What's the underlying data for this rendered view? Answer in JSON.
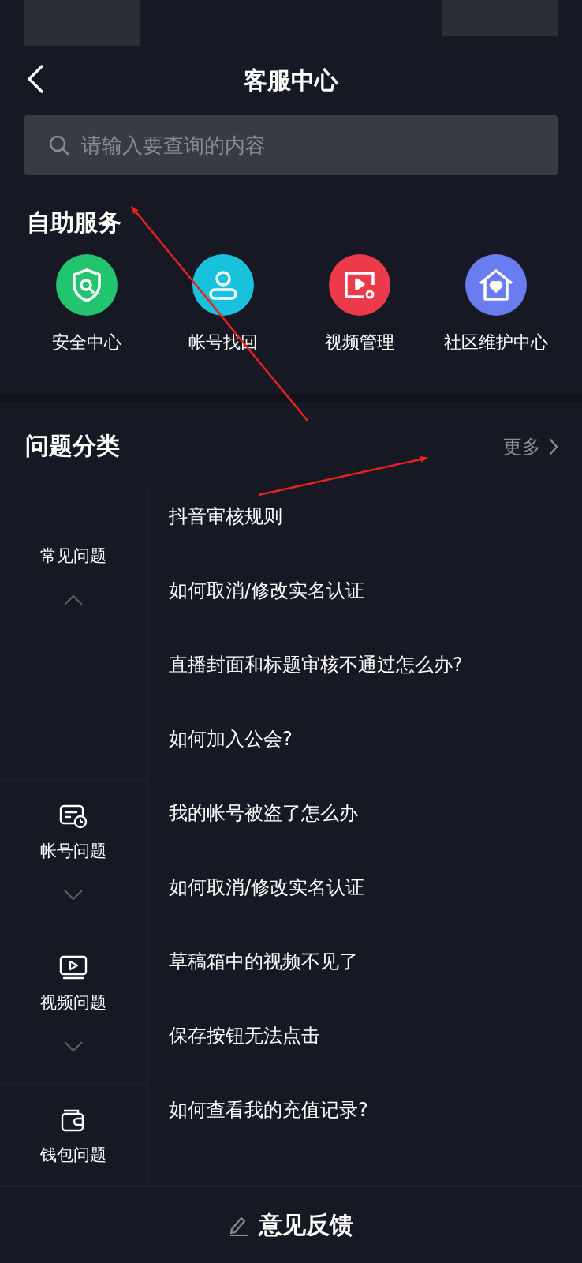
{
  "header": {
    "title": "客服中心"
  },
  "search": {
    "placeholder": "请输入要查询的内容"
  },
  "self_service": {
    "title": "自助服务",
    "items": [
      {
        "label": "安全中心",
        "kind": "shield",
        "color": "#22c56e"
      },
      {
        "label": "帐号找回",
        "kind": "person",
        "color": "#18c2dd"
      },
      {
        "label": "视频管理",
        "kind": "video",
        "color": "#ec3a4b"
      },
      {
        "label": "社区维护中心",
        "kind": "house",
        "color": "#6a7df0"
      }
    ]
  },
  "categories_section": {
    "title": "问题分类",
    "more": "更多"
  },
  "categories": [
    {
      "label": "常见问题",
      "kind": "none",
      "expanded": true
    },
    {
      "label": "帐号问题",
      "kind": "account",
      "expanded": false
    },
    {
      "label": "视频问题",
      "kind": "video",
      "expanded": false
    },
    {
      "label": "钱包问题",
      "kind": "wallet"
    }
  ],
  "questions": [
    "抖音审核规则",
    "如何取消/修改实名认证",
    "直播封面和标题审核不通过怎么办?",
    "如何加入公会?",
    "我的帐号被盗了怎么办",
    "如何取消/修改实名认证",
    "草稿箱中的视频不见了",
    "保存按钮无法点击",
    "如何查看我的充值记录?"
  ],
  "footer": {
    "label": "意见反馈"
  }
}
